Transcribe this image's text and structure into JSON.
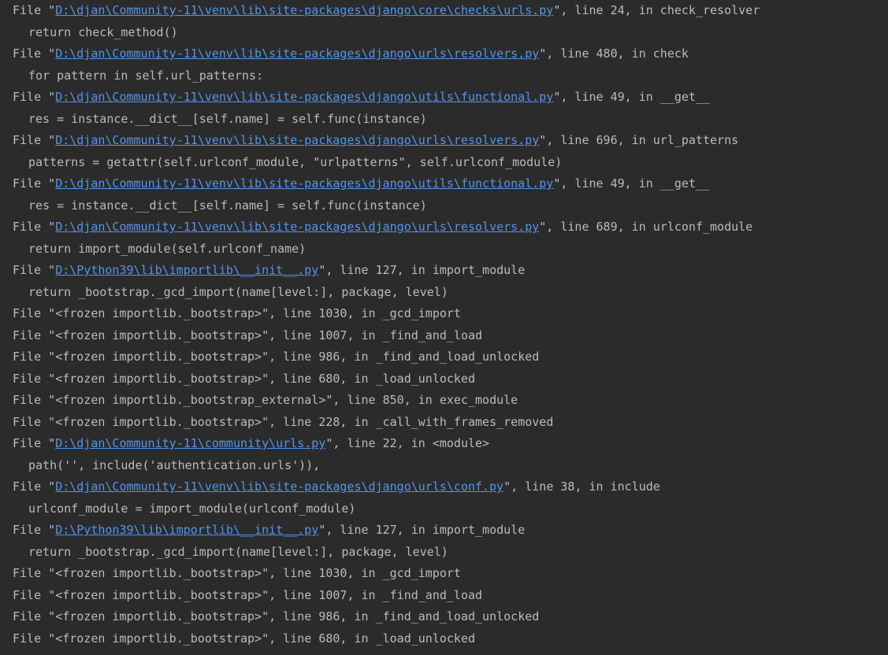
{
  "theme": {
    "background": "#2b2b2b",
    "text": "#bbbbbb",
    "link": "#5394ec"
  },
  "traceback": [
    {
      "type": "frame",
      "path": "D:\\djan\\Community-11\\venv\\lib\\site-packages\\django\\core\\checks\\urls.py",
      "link": true,
      "rest": "\", line 24, in check_resolver"
    },
    {
      "type": "code",
      "text": "return check_method()"
    },
    {
      "type": "frame",
      "path": "D:\\djan\\Community-11\\venv\\lib\\site-packages\\django\\urls\\resolvers.py",
      "link": true,
      "rest": "\", line 480, in check"
    },
    {
      "type": "code",
      "text": "for pattern in self.url_patterns:"
    },
    {
      "type": "frame",
      "path": "D:\\djan\\Community-11\\venv\\lib\\site-packages\\django\\utils\\functional.py",
      "link": true,
      "rest": "\", line 49, in __get__"
    },
    {
      "type": "code",
      "text": "res = instance.__dict__[self.name] = self.func(instance)"
    },
    {
      "type": "frame",
      "path": "D:\\djan\\Community-11\\venv\\lib\\site-packages\\django\\urls\\resolvers.py",
      "link": true,
      "rest": "\", line 696, in url_patterns"
    },
    {
      "type": "code",
      "text": "patterns = getattr(self.urlconf_module, \"urlpatterns\", self.urlconf_module)"
    },
    {
      "type": "frame",
      "path": "D:\\djan\\Community-11\\venv\\lib\\site-packages\\django\\utils\\functional.py",
      "link": true,
      "rest": "\", line 49, in __get__"
    },
    {
      "type": "code",
      "text": "res = instance.__dict__[self.name] = self.func(instance)"
    },
    {
      "type": "frame",
      "path": "D:\\djan\\Community-11\\venv\\lib\\site-packages\\django\\urls\\resolvers.py",
      "link": true,
      "rest": "\", line 689, in urlconf_module"
    },
    {
      "type": "code",
      "text": "return import_module(self.urlconf_name)"
    },
    {
      "type": "frame",
      "path": "D:\\Python39\\lib\\importlib\\__init__.py",
      "link": true,
      "rest": "\", line 127, in import_module"
    },
    {
      "type": "code",
      "text": "return _bootstrap._gcd_import(name[level:], package, level)"
    },
    {
      "type": "frame",
      "path": "<frozen importlib._bootstrap>",
      "link": false,
      "rest": "\", line 1030, in _gcd_import"
    },
    {
      "type": "frame",
      "path": "<frozen importlib._bootstrap>",
      "link": false,
      "rest": "\", line 1007, in _find_and_load"
    },
    {
      "type": "frame",
      "path": "<frozen importlib._bootstrap>",
      "link": false,
      "rest": "\", line 986, in _find_and_load_unlocked"
    },
    {
      "type": "frame",
      "path": "<frozen importlib._bootstrap>",
      "link": false,
      "rest": "\", line 680, in _load_unlocked"
    },
    {
      "type": "frame",
      "path": "<frozen importlib._bootstrap_external>",
      "link": false,
      "rest": "\", line 850, in exec_module"
    },
    {
      "type": "frame",
      "path": "<frozen importlib._bootstrap>",
      "link": false,
      "rest": "\", line 228, in _call_with_frames_removed"
    },
    {
      "type": "frame",
      "path": "D:\\djan\\Community-11\\community\\urls.py",
      "link": true,
      "rest": "\", line 22, in <module>"
    },
    {
      "type": "code",
      "text": "path('', include('authentication.urls')),"
    },
    {
      "type": "frame",
      "path": "D:\\djan\\Community-11\\venv\\lib\\site-packages\\django\\urls\\conf.py",
      "link": true,
      "rest": "\", line 38, in include"
    },
    {
      "type": "code",
      "text": "urlconf_module = import_module(urlconf_module)"
    },
    {
      "type": "frame",
      "path": "D:\\Python39\\lib\\importlib\\__init__.py",
      "link": true,
      "rest": "\", line 127, in import_module"
    },
    {
      "type": "code",
      "text": "return _bootstrap._gcd_import(name[level:], package, level)"
    },
    {
      "type": "frame",
      "path": "<frozen importlib._bootstrap>",
      "link": false,
      "rest": "\", line 1030, in _gcd_import"
    },
    {
      "type": "frame",
      "path": "<frozen importlib._bootstrap>",
      "link": false,
      "rest": "\", line 1007, in _find_and_load"
    },
    {
      "type": "frame",
      "path": "<frozen importlib._bootstrap>",
      "link": false,
      "rest": "\", line 986, in _find_and_load_unlocked"
    },
    {
      "type": "frame",
      "path": "<frozen importlib._bootstrap>",
      "link": false,
      "rest": "\", line 680, in _load_unlocked"
    }
  ],
  "labels": {
    "file_prefix": "File \""
  }
}
